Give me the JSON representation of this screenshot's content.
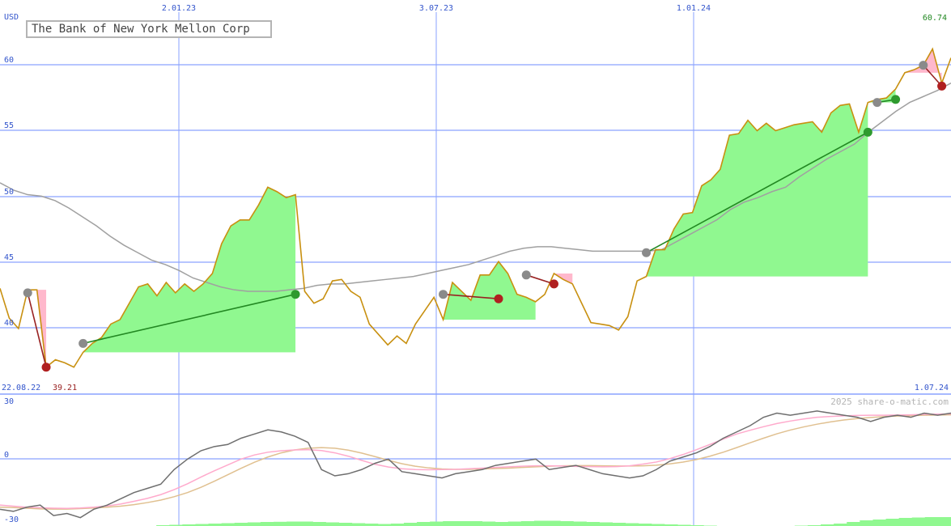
{
  "chart_data": [
    {
      "type": "line",
      "title": "The Bank of New York Mellon Corp",
      "ylabel": "USD",
      "ylim": [
        37.5,
        62.8
      ],
      "y_ticks": [
        "40",
        "45",
        "50",
        "55",
        "60"
      ],
      "x_ticks": [
        "2.01.23",
        "3.07.23",
        "1.01.24"
      ],
      "x_range": [
        "22.08.22",
        "1.07.24"
      ],
      "last_value": "60.74",
      "min_label": "39.21",
      "colors": {
        "price": "#c89010",
        "ma": "#a0a0a0",
        "gain": "#90f890",
        "loss": "#ffb8cc",
        "grid": "#8aa2ff"
      },
      "series": [
        {
          "name": "",
          "values": [
            44.5,
            42.5,
            41.8,
            44.4,
            44.4,
            39.2,
            39.7,
            39.5,
            39.2,
            40.2,
            40.8,
            41.2,
            42.1,
            42.4,
            43.5,
            44.6,
            44.8,
            44.0,
            44.9,
            44.2,
            44.8,
            44.3,
            44.8,
            45.5,
            47.5,
            48.7,
            49.1,
            49.1,
            50.1,
            51.3,
            51.0,
            50.6,
            50.8,
            44.3,
            43.5,
            43.8,
            45.0,
            45.1,
            44.3,
            43.9,
            42.1,
            41.4,
            40.7,
            41.3,
            40.8,
            42.1,
            43.0,
            43.9,
            42.4,
            44.9,
            44.3,
            43.7,
            45.4,
            45.4,
            46.3,
            45.5,
            44.1,
            43.9,
            43.6,
            44.1,
            45.5,
            45.1,
            44.8,
            43.5,
            42.2,
            42.1,
            42.0,
            41.7,
            42.6,
            45.0,
            45.3,
            47.1,
            47.1,
            48.5,
            49.5,
            49.6,
            51.4,
            51.8,
            52.5,
            54.8,
            54.9,
            55.8,
            55.1,
            55.6,
            55.1,
            55.3,
            55.5,
            55.6,
            55.7,
            55.0,
            56.3,
            56.8,
            56.9,
            55.0,
            57.0,
            57.2,
            57.3,
            57.9,
            59.0,
            59.2,
            59.5,
            60.6,
            58.3,
            60.0
          ]
        },
        {
          "name": "",
          "values": [
            51.6,
            51.1,
            50.8,
            50.7,
            50.4,
            49.9,
            49.3,
            48.7,
            48.0,
            47.4,
            46.9,
            46.4,
            46.1,
            45.7,
            45.2,
            44.9,
            44.6,
            44.4,
            44.3,
            44.3,
            44.3,
            44.4,
            44.5,
            44.7,
            44.8,
            44.8,
            44.9,
            45.0,
            45.1,
            45.2,
            45.3,
            45.5,
            45.7,
            45.9,
            46.1,
            46.4,
            46.7,
            47.0,
            47.2,
            47.3,
            47.3,
            47.2,
            47.1,
            47.0,
            47.0,
            47.0,
            47.0,
            47.0,
            47.1,
            47.6,
            48.1,
            48.6,
            49.1,
            49.8,
            50.3,
            50.6,
            51.0,
            51.3,
            52.0,
            52.6,
            53.2,
            53.7,
            54.2,
            55.0,
            55.7,
            56.4,
            57.0,
            57.4,
            57.8,
            58.3
          ]
        }
      ],
      "trades": [
        {
          "type": "loss",
          "from": 44.2,
          "to": 39.2
        },
        {
          "type": "gain",
          "from": 40.8,
          "to": 44.1
        },
        {
          "type": "loss",
          "from": 44.1,
          "to": 43.8
        },
        {
          "type": "loss",
          "from": 45.4,
          "to": 44.8
        },
        {
          "type": "gain",
          "from": 46.9,
          "to": 55.0
        },
        {
          "type": "gain",
          "from": 57.0,
          "to": 57.2
        },
        {
          "type": "loss",
          "from": 59.5,
          "to": 58.1
        }
      ]
    },
    {
      "type": "line",
      "ylim": [
        -30,
        30
      ],
      "y_ticks": [
        "30",
        "0",
        "-30"
      ],
      "watermark": "2025 share-o-matic.com",
      "colors": {
        "momentum": "#6e6e6e",
        "fast": "#ffaacc",
        "slow": "#e0c090",
        "bars": "#90f890"
      },
      "series": [
        {
          "name": "",
          "values": [
            -22,
            -23,
            -21,
            -20,
            -25,
            -24,
            -26,
            -22,
            -20,
            -17,
            -14,
            -12,
            -10,
            -3,
            2,
            6,
            8,
            9,
            12,
            14,
            16,
            15,
            13,
            10,
            -3,
            -6,
            -5,
            -3,
            0,
            2,
            -4,
            -5,
            -6,
            -7,
            -5,
            -4,
            -3,
            -1,
            0,
            1,
            2,
            -3,
            -2,
            -1,
            -3,
            -5,
            -6,
            -7,
            -6,
            -3,
            1,
            3,
            5,
            8,
            12,
            15,
            18,
            22,
            24,
            23,
            24,
            25,
            24,
            23,
            22,
            20,
            22,
            23,
            22,
            24,
            23,
            24
          ]
        },
        {
          "name": "",
          "values": [
            -20,
            -20.5,
            -21,
            -21.3,
            -21.5,
            -21.6,
            -21.4,
            -21,
            -20.4,
            -19.5,
            -18.2,
            -16.8,
            -15,
            -12.6,
            -9.8,
            -6.6,
            -3.6,
            -0.8,
            2,
            4,
            5.3,
            6,
            6.4,
            6.5,
            6.1,
            5,
            3.4,
            1.4,
            -0.5,
            -1.8,
            -2.6,
            -3,
            -3.1,
            -3,
            -2.9,
            -2.6,
            -2.3,
            -2,
            -1.7,
            -1.4,
            -1.2,
            -1.2,
            -1.3,
            -1.5,
            -1.6,
            -1.7,
            -1.6,
            -1.2,
            -0.4,
            0.6,
            2.2,
            4.2,
            6.5,
            9,
            11.6,
            14,
            15.8,
            17.5,
            19,
            20.2,
            21.2,
            22,
            22.4,
            22.7,
            22.9,
            23,
            23,
            23.1,
            23.2,
            23.4,
            23.5,
            23.6
          ]
        },
        {
          "name": "",
          "values": [
            -21,
            -21.2,
            -21.5,
            -21.8,
            -21.9,
            -21.9,
            -21.7,
            -21.4,
            -21,
            -20.5,
            -19.8,
            -18.8,
            -17.6,
            -16,
            -14,
            -11.5,
            -8.6,
            -5.5,
            -2.4,
            0.5,
            3,
            5,
            6.4,
            7.2,
            7.5,
            7.2,
            6.3,
            4.9,
            3.2,
            1.4,
            -0.2,
            -1.4,
            -2.2,
            -2.7,
            -2.9,
            -2.9,
            -2.7,
            -2.5,
            -2.3,
            -2,
            -1.7,
            -1.4,
            -1.2,
            -1.1,
            -1.1,
            -1.2,
            -1.3,
            -1.3,
            -1.2,
            -0.9,
            -0.3,
            0.6,
            1.8,
            3.4,
            5.3,
            7.5,
            9.8,
            12,
            14.1,
            15.9,
            17.4,
            18.7,
            19.8,
            20.7,
            21.4,
            21.9,
            22.3,
            22.6,
            22.8,
            23,
            23.1,
            23.2
          ]
        }
      ],
      "bars": [
        0,
        0,
        0,
        0,
        0,
        0,
        0,
        0,
        0,
        0,
        0,
        0,
        1,
        1.5,
        2,
        2.5,
        3,
        3.5,
        4,
        4.5,
        5,
        5.2,
        5.5,
        5.5,
        5,
        4.5,
        4,
        3.5,
        3,
        2.5,
        3,
        4,
        5,
        5.5,
        6,
        6,
        6,
        5.5,
        5,
        5.5,
        6,
        6.5,
        6.5,
        6,
        5.5,
        5,
        4.5,
        4,
        3.5,
        3,
        2.5,
        2,
        1.5,
        1,
        0.5,
        0,
        0,
        0,
        0,
        0,
        0,
        0.5,
        1,
        2,
        3,
        5,
        7,
        8,
        9,
        10,
        10.5,
        11,
        11
      ]
    }
  ]
}
